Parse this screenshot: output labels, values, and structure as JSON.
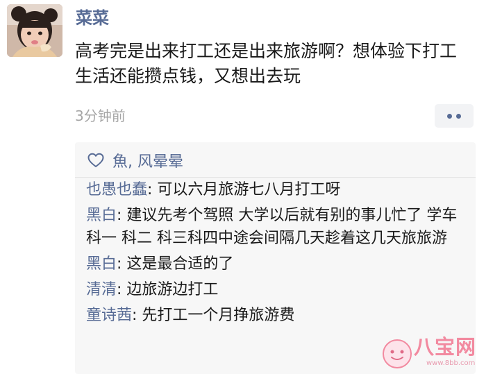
{
  "post": {
    "author": "菜菜",
    "text": "高考完是出来打工还是出来旅游啊？想体验下打工生活还能攒点钱，又想出去玩",
    "time": "3分钟前"
  },
  "likes": {
    "icon": "heart-outline-icon",
    "names": "魚, 风晕晕"
  },
  "comments": [
    {
      "name": "也愚也蠢",
      "text": "可以六月旅游七八月打工呀"
    },
    {
      "name": "黑白",
      "text": "建议先考个驾照 大学以后就有别的事儿忙了 学车科一 科二 科三科四中途会间隔几天趁着这几天旅旅游"
    },
    {
      "name": "黑白",
      "text": "这是最合适的了"
    },
    {
      "name": "清清",
      "text": "边旅游边打工"
    },
    {
      "name": "童诗茜",
      "text": "先打工一个月挣旅游费"
    }
  ],
  "comment_separator": ": ",
  "watermark": {
    "brand": "八宝网",
    "url": "www.8bb.com"
  },
  "colors": {
    "name_blue": "#576b95",
    "text": "#191919",
    "time_gray": "#a6a6a6",
    "comment_bg": "#f7f7f7",
    "watermark_pink": "#f28aa0"
  }
}
